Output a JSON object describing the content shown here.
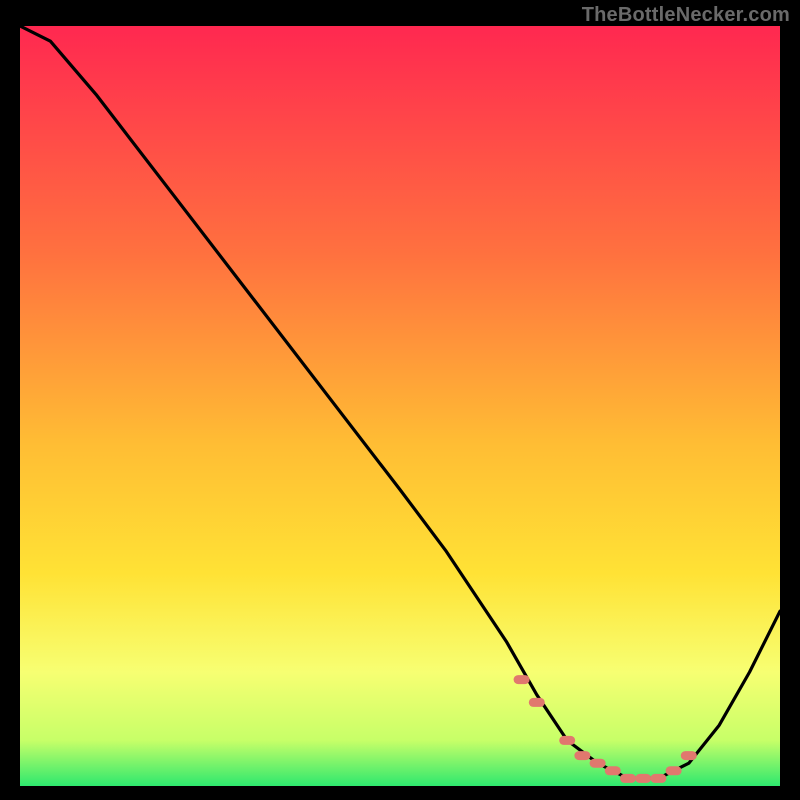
{
  "watermark": "TheBottleNecker.com",
  "colors": {
    "gradient_top": "#ff2850",
    "gradient_mid1": "#ff8a3c",
    "gradient_mid2": "#ffe235",
    "gradient_mid3": "#f8ff6b",
    "gradient_bottom": "#2ee86e",
    "curve": "#000000",
    "marker_fill": "#e1786e",
    "frame_bg": "#000000"
  },
  "chart_data": {
    "type": "line",
    "title": "",
    "xlabel": "",
    "ylabel": "",
    "xlim": [
      0,
      100
    ],
    "ylim": [
      0,
      100
    ],
    "grid": false,
    "legend": false,
    "series": [
      {
        "name": "bottleneck_curve",
        "x": [
          0,
          4,
          10,
          20,
          30,
          40,
          50,
          56,
          60,
          64,
          68,
          72,
          76,
          80,
          84,
          88,
          92,
          96,
          100
        ],
        "y": [
          100,
          98,
          91,
          78,
          65,
          52,
          39,
          31,
          25,
          19,
          12,
          6,
          3,
          1,
          1,
          3,
          8,
          15,
          23
        ]
      }
    ],
    "markers": {
      "name": "highlighted_points",
      "x": [
        66,
        68,
        72,
        74,
        76,
        78,
        80,
        82,
        84,
        86,
        88
      ],
      "y": [
        14,
        11,
        6,
        4,
        3,
        2,
        1,
        1,
        1,
        2,
        4
      ]
    },
    "background_gradient_stops": [
      {
        "offset": 0.0,
        "color": "#ff2850"
      },
      {
        "offset": 0.3,
        "color": "#ff713f"
      },
      {
        "offset": 0.55,
        "color": "#ffbd34"
      },
      {
        "offset": 0.72,
        "color": "#ffe235"
      },
      {
        "offset": 0.85,
        "color": "#f7ff72"
      },
      {
        "offset": 0.94,
        "color": "#c7ff68"
      },
      {
        "offset": 1.0,
        "color": "#2ee86e"
      }
    ]
  }
}
